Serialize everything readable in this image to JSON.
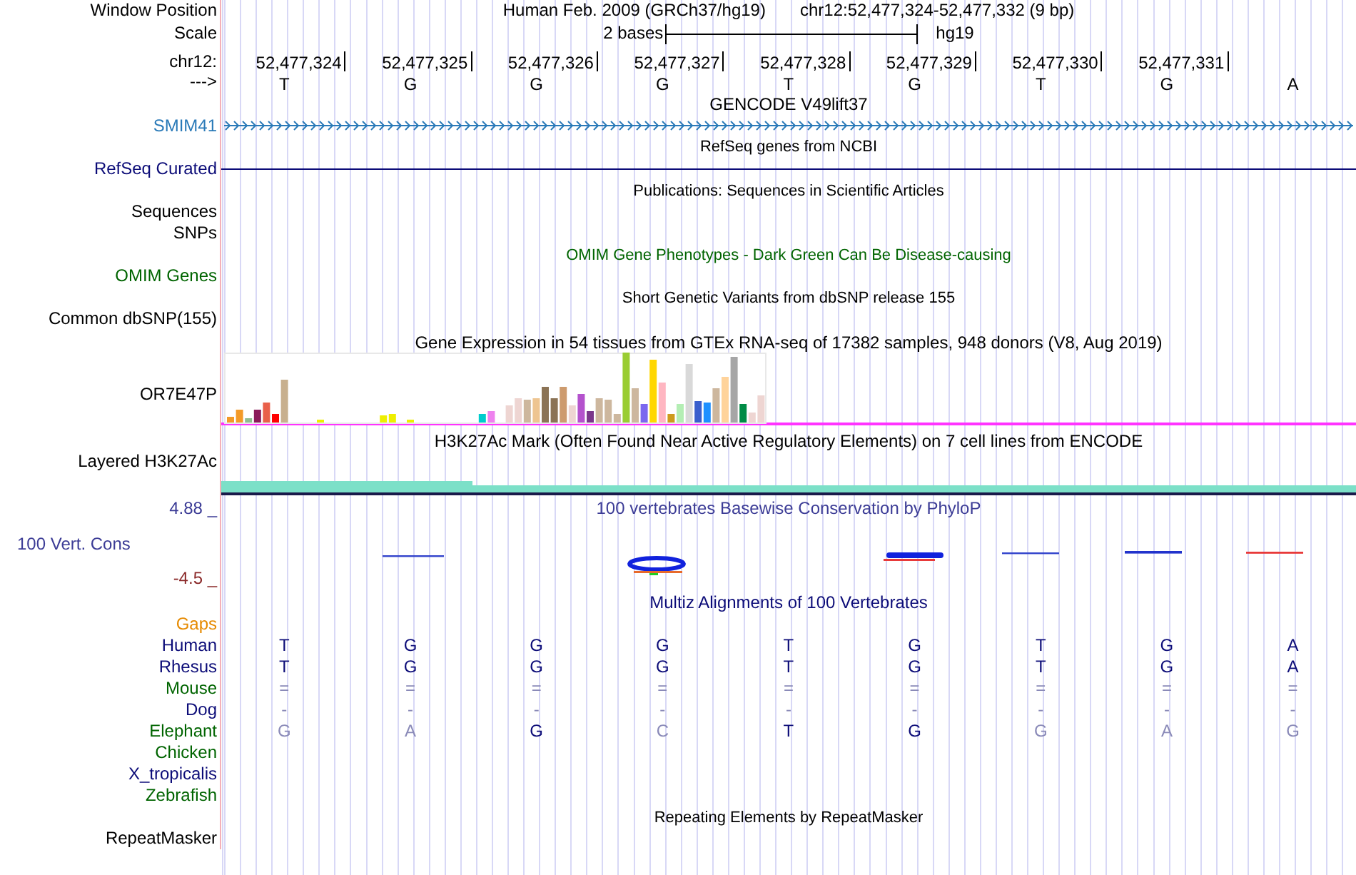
{
  "header": {
    "labels": [
      "Window Position",
      "Scale",
      "chr12:",
      "--->"
    ],
    "assembly": "Human Feb. 2009 (GRCh37/hg19)",
    "position": "chr12:52,477,324-52,477,332 (9 bp)",
    "scale_length": "2 bases",
    "scale_assembly": "hg19",
    "ruler": [
      "52,477,324",
      "52,477,325",
      "52,477,326",
      "52,477,327",
      "52,477,328",
      "52,477,329",
      "52,477,330",
      "52,477,331"
    ],
    "bases": [
      "T",
      "G",
      "G",
      "G",
      "T",
      "G",
      "T",
      "G",
      "A"
    ]
  },
  "tracks": [
    {
      "kind": "gene",
      "title": "GENCODE V49lift37",
      "color": "#000000",
      "labels": [
        {
          "text": "SMIM41",
          "color": "#2a7ab8"
        }
      ]
    },
    {
      "kind": "line",
      "title": "RefSeq genes from NCBI",
      "color": "#000000",
      "labels": [
        {
          "text": "RefSeq Curated",
          "color": "#0c0c78"
        }
      ]
    },
    {
      "kind": "blank",
      "title": "Publications: Sequences in Scientific Articles",
      "color": "#000000",
      "labels": [
        {
          "text": "Sequences",
          "color": "#000000"
        },
        {
          "text": "SNPs",
          "color": "#000000"
        }
      ]
    },
    {
      "kind": "blank",
      "title": "OMIM Gene Phenotypes - Dark Green Can Be Disease-causing",
      "color": "#006400",
      "labels": [
        {
          "text": "OMIM Genes",
          "color": "#006400"
        }
      ]
    },
    {
      "kind": "blank",
      "title": "Short Genetic Variants from dbSNP release 155",
      "color": "#000000",
      "labels": [
        {
          "text": "Common dbSNP(155)",
          "color": "#000000"
        }
      ]
    },
    {
      "kind": "bars",
      "title": "Gene Expression in 54 tissues from GTEx RNA-seq of 17382 samples, 948 donors (V8, Aug 2019)",
      "color": "#000000",
      "labels": [
        {
          "text": "OR7E47P",
          "color": "#000000"
        }
      ]
    },
    {
      "kind": "signal",
      "title": "H3K27Ac Mark (Often Found Near Active Regulatory Elements) on 7 cell lines from ENCODE",
      "color": "#000000",
      "labels": [
        {
          "text": "Layered H3K27Ac",
          "color": "#000000"
        }
      ]
    },
    {
      "kind": "conservation",
      "title": "100 vertebrates Basewise Conservation by PhyloP",
      "color": "#3c3c96",
      "labels": [
        {
          "text": "4.88 _",
          "color": "#3c3c96"
        },
        {
          "text": "100 Vert. Cons",
          "color": "#3c3c96"
        },
        {
          "text": "-4.5 _",
          "color": "#8b2a2a"
        }
      ]
    },
    {
      "kind": "alignment",
      "title": "Multiz Alignments of 100 Vertebrates",
      "color": "#0c0c78",
      "rows": [
        {
          "label": "Gaps",
          "color": "#e68a00",
          "cells": []
        },
        {
          "label": "Human",
          "color": "#0c0c78",
          "cells": [
            {
              "text": "T",
              "faded": false
            },
            {
              "text": "G",
              "faded": false
            },
            {
              "text": "G",
              "faded": false
            },
            {
              "text": "G",
              "faded": false
            },
            {
              "text": "T",
              "faded": false
            },
            {
              "text": "G",
              "faded": false
            },
            {
              "text": "T",
              "faded": false
            },
            {
              "text": "G",
              "faded": false
            },
            {
              "text": "A",
              "faded": false
            }
          ]
        },
        {
          "label": "Rhesus",
          "color": "#0c0c78",
          "cells": [
            {
              "text": "T",
              "faded": false
            },
            {
              "text": "G",
              "faded": false
            },
            {
              "text": "G",
              "faded": false
            },
            {
              "text": "G",
              "faded": false
            },
            {
              "text": "T",
              "faded": false
            },
            {
              "text": "G",
              "faded": false
            },
            {
              "text": "T",
              "faded": false
            },
            {
              "text": "G",
              "faded": false
            },
            {
              "text": "A",
              "faded": false
            }
          ]
        },
        {
          "label": "Mouse",
          "color": "#006400",
          "cells": [
            {
              "text": "=",
              "faded": true
            },
            {
              "text": "=",
              "faded": true
            },
            {
              "text": "=",
              "faded": true
            },
            {
              "text": "=",
              "faded": true
            },
            {
              "text": "=",
              "faded": true
            },
            {
              "text": "=",
              "faded": true
            },
            {
              "text": "=",
              "faded": true
            },
            {
              "text": "=",
              "faded": true
            },
            {
              "text": "=",
              "faded": true
            }
          ]
        },
        {
          "label": "Dog",
          "color": "#0c0c78",
          "cells": [
            {
              "text": "-",
              "faded": true
            },
            {
              "text": "-",
              "faded": true
            },
            {
              "text": "-",
              "faded": true
            },
            {
              "text": "-",
              "faded": true
            },
            {
              "text": "-",
              "faded": true
            },
            {
              "text": "-",
              "faded": true
            },
            {
              "text": "-",
              "faded": true
            },
            {
              "text": "-",
              "faded": true
            },
            {
              "text": "-",
              "faded": true
            }
          ]
        },
        {
          "label": "Elephant",
          "color": "#006400",
          "cells": [
            {
              "text": "G",
              "faded": true
            },
            {
              "text": "A",
              "faded": true
            },
            {
              "text": "G",
              "faded": false
            },
            {
              "text": "C",
              "faded": true
            },
            {
              "text": "T",
              "faded": false
            },
            {
              "text": "G",
              "faded": false
            },
            {
              "text": "G",
              "faded": true
            },
            {
              "text": "A",
              "faded": true
            },
            {
              "text": "G",
              "faded": true
            }
          ]
        },
        {
          "label": "Chicken",
          "color": "#006400",
          "cells": []
        },
        {
          "label": "X_tropicalis",
          "color": "#0c0c78",
          "cells": []
        },
        {
          "label": "Zebrafish",
          "color": "#006400",
          "cells": []
        }
      ]
    },
    {
      "kind": "blank",
      "title": "Repeating Elements by RepeatMasker",
      "color": "#000000",
      "labels": [
        {
          "text": "RepeatMasker",
          "color": "#000000"
        }
      ]
    }
  ]
}
